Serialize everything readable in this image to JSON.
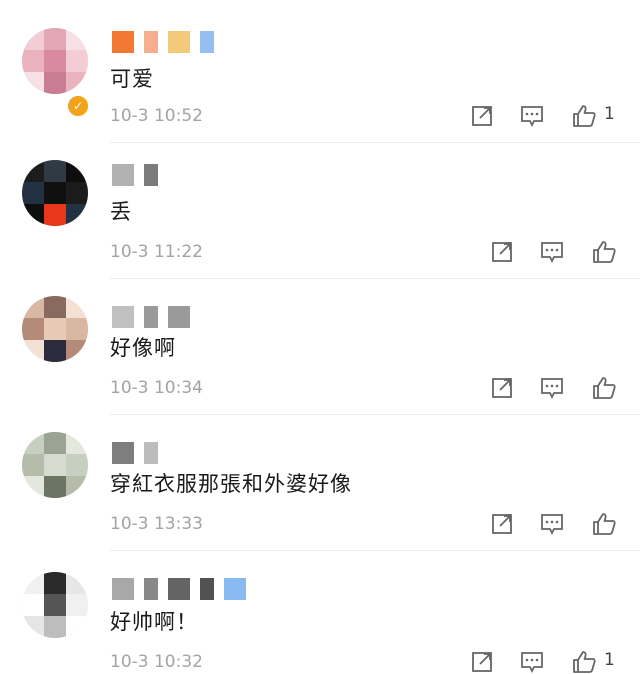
{
  "comments": [
    {
      "text": "可爱",
      "time": "10-3 10:52",
      "like_count": "1",
      "verified": true,
      "avatar_colors": [
        "#f2cdd5",
        "#e3a6b3",
        "#f6dfe5",
        "#c97d92",
        "#e9b3c0",
        "#d98aa0"
      ],
      "name_colors": [
        "#f06a1d",
        "#f5a582",
        "#f2c46c",
        "#8bb7f0"
      ]
    },
    {
      "text": "丢",
      "time": "10-3 11:22",
      "like_count": "",
      "verified": false,
      "avatar_colors": [
        "#1c1c1c",
        "#2f3a44",
        "#0e0e0e",
        "#e8371b",
        "#233243",
        "#101010"
      ],
      "name_colors": [
        "#a9a9a9",
        "#6d6d6d"
      ]
    },
    {
      "text": "好像啊",
      "time": "10-3 10:34",
      "like_count": "",
      "verified": false,
      "avatar_colors": [
        "#d9b8a3",
        "#8a6a5e",
        "#f3e1d6",
        "#2c2b3e",
        "#b48b78",
        "#e7c9b8"
      ],
      "name_colors": [
        "#b9b9b9",
        "#8f8f8f",
        "#8f8f8f"
      ]
    },
    {
      "text": "穿紅衣服那張和外婆好像",
      "time": "10-3 13:33",
      "like_count": "",
      "verified": false,
      "avatar_colors": [
        "#c7cfc1",
        "#9aa492",
        "#e3e7de",
        "#6c7464",
        "#b5bcaa",
        "#d6dbd0"
      ],
      "name_colors": [
        "#707070",
        "#b5b5b5"
      ]
    },
    {
      "text": "好帅啊！",
      "time": "10-3 10:32",
      "like_count": "1",
      "verified": false,
      "avatar_colors": [
        "#f0f0f0",
        "#2a2a2a",
        "#e6e6e6",
        "#bdbdbd",
        "#ffffff",
        "#555555"
      ],
      "name_colors": [
        "#9e9e9e",
        "#7b7b7b",
        "#535353",
        "#3f3f3f",
        "#7ab2ee"
      ]
    }
  ],
  "icons": {
    "share": "share-icon",
    "reply": "comment-icon",
    "like": "thumbs-up-icon"
  },
  "colors": {
    "verified_badge": "#f2a21b",
    "text": "#1a1a1a",
    "meta": "#a3a3a3",
    "divider": "#ececec"
  }
}
